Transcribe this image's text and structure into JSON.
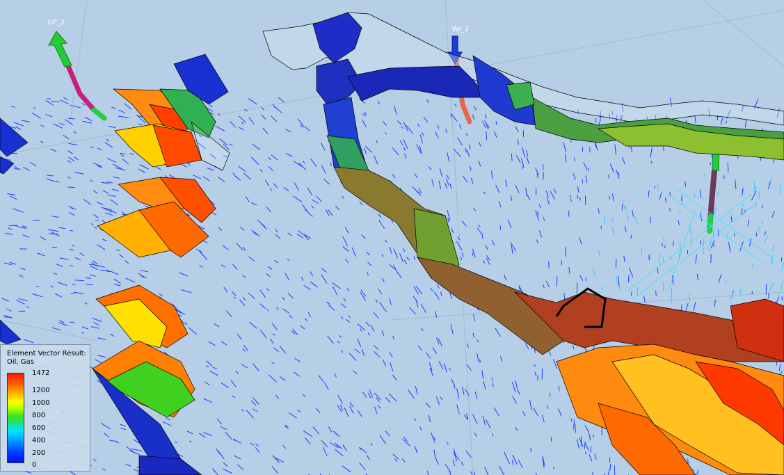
{
  "wells": {
    "op2": {
      "name": "OP_2"
    },
    "wi2": {
      "name": "WI_2"
    }
  },
  "legend": {
    "title_line1": "Element Vector Result:",
    "title_line2": "Oil, Gas",
    "ticks": [
      "1472",
      "1200",
      "1000",
      "800",
      "600",
      "400",
      "200",
      "0"
    ]
  },
  "colors": {
    "background": "#b6cfe6",
    "vector_blue": "#1a3cff",
    "vector_cyan": "#2ec8ff",
    "high": "#ff2a00",
    "mid_high": "#ff8a00",
    "mid": "#ffe000",
    "low_mid": "#40d020",
    "low": "#0018d8"
  }
}
